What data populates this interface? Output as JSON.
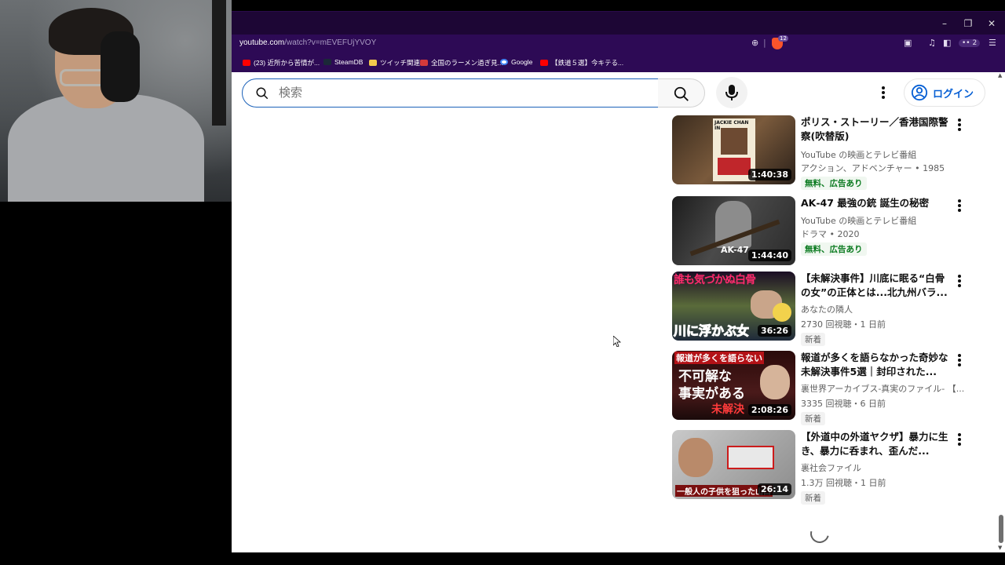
{
  "browser": {
    "url_host": "youtube.com",
    "url_path": "/watch?v=mEVEFUjYVOY",
    "brave_shield_count": "12",
    "extension_count": "2",
    "window_controls": [
      "minimize-icon",
      "restore-icon",
      "close-icon"
    ]
  },
  "bookmarks": [
    {
      "label": "(23) 近所から苦情が...",
      "icon": "youtube-icon",
      "color": "#ff0000"
    },
    {
      "label": "SteamDB",
      "icon": "steamdb-icon",
      "color": "#1b2838"
    },
    {
      "label": "ツイッチ関連",
      "icon": "folder-icon",
      "color": "#f2c94c"
    },
    {
      "label": "全国のラーメン過ぎ見...",
      "icon": "ramen-site-icon",
      "color": "#d43a3a"
    },
    {
      "label": "Google",
      "icon": "google-icon",
      "color": "#4285f4"
    },
    {
      "label": "【鉄道５選】今キテる...",
      "icon": "youtube-icon",
      "color": "#ff0000"
    }
  ],
  "header": {
    "search_placeholder": "検索",
    "login_label": "ログイン"
  },
  "videos": [
    {
      "title": "ポリス・ストーリー／香港国際警察(吹替版)",
      "channel": "YouTube の映画とテレビ番組",
      "meta": "アクション、アドベンチャー • 1985",
      "badge": "無料、広告あり",
      "duration": "1:40:38",
      "thumb_text": "JACKIE CHAN IN"
    },
    {
      "title": "AK‐47 最強の銃 誕生の秘密",
      "channel": "YouTube の映画とテレビ番組",
      "meta": "ドラマ • 2020",
      "badge": "無料、広告あり",
      "duration": "1:44:40",
      "thumb_text": "AK-47"
    },
    {
      "title": "【未解決事件】川底に眠る“白骨の女”の正体とは...北九州バラ...",
      "channel": "あなたの隣人",
      "meta": "2730 回視聴・1 日前",
      "badge": "新着",
      "duration": "36:26",
      "thumb_text_top": "誰も気づかぬ白骨",
      "thumb_text_bottom": "川に浮かぶ女"
    },
    {
      "title": "報道が多くを語らなかった奇妙な未解決事件5選｜封印された...",
      "channel": "裏世界アーカイブス-真実のファイル- 【...",
      "meta": "3335 回視聴・6 日前",
      "badge": "新着",
      "duration": "2:08:26",
      "thumb_text_top": "報道が多くを語らない",
      "thumb_text_mid1": "不可解な",
      "thumb_text_mid2": "事実がある",
      "thumb_text_bottom": "未解決"
    },
    {
      "title": "【外道中の外道ヤクザ】暴力に生き、暴力に呑まれ、歪んだ...",
      "channel": "裏社会ファイル",
      "meta": "1.3万 回視聴・1 日前",
      "badge": "新着",
      "duration": "26:14",
      "thumb_text_bottom": "一般人の子供を狙った山口"
    }
  ]
}
